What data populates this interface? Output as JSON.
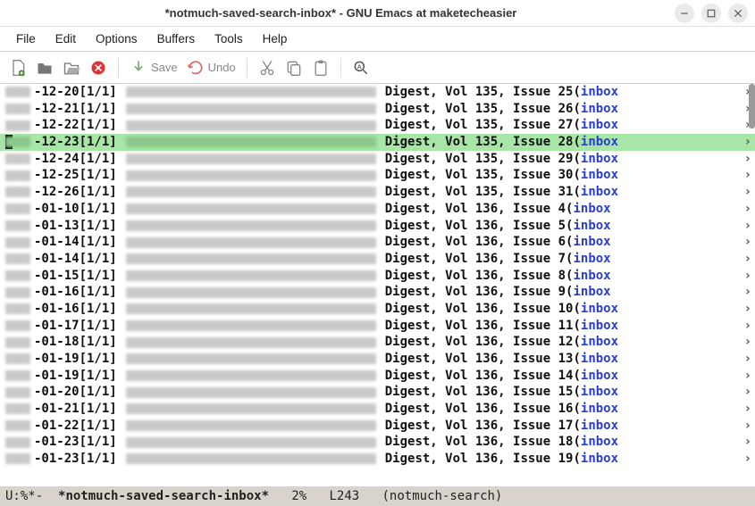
{
  "window": {
    "title": "*notmuch-saved-search-inbox* - GNU Emacs at maketecheasier"
  },
  "menu": {
    "items": [
      "File",
      "Edit",
      "Options",
      "Buffers",
      "Tools",
      "Help"
    ]
  },
  "toolbar": {
    "save_label": "Save",
    "undo_label": "Undo"
  },
  "modeline": {
    "status": "U:%*-",
    "buffer": "*notmuch-saved-search-inbox*",
    "percent": "2%",
    "line": "L243",
    "mode": "(notmuch-search)"
  },
  "selected_index": 3,
  "rows": [
    {
      "date": "-12-20",
      "count": "[1/1]",
      "subject": "Digest, Vol 135, Issue 25",
      "tag": "inbox",
      "arrow": "›"
    },
    {
      "date": "-12-21",
      "count": "[1/1]",
      "subject": "Digest, Vol 135, Issue 26",
      "tag": "inbox",
      "arrow": "›"
    },
    {
      "date": "-12-22",
      "count": "[1/1]",
      "subject": "Digest, Vol 135, Issue 27",
      "tag": "inbox",
      "arrow": "›"
    },
    {
      "date": "-12-23",
      "count": "[1/1]",
      "subject": "Digest, Vol 135, Issue 28",
      "tag": "inbox",
      "arrow": "›"
    },
    {
      "date": "-12-24",
      "count": "[1/1]",
      "subject": "Digest, Vol 135, Issue 29",
      "tag": "inbox",
      "arrow": "›"
    },
    {
      "date": "-12-25",
      "count": "[1/1]",
      "subject": "Digest, Vol 135, Issue 30",
      "tag": "inbox",
      "arrow": "›"
    },
    {
      "date": "-12-26",
      "count": "[1/1]",
      "subject": "Digest, Vol 135, Issue 31",
      "tag": "inbox",
      "arrow": "›"
    },
    {
      "date": "-01-10",
      "count": "[1/1]",
      "subject": "Digest, Vol 136, Issue 4",
      "tag": "inbox",
      "arrow": "›",
      "pad": " "
    },
    {
      "date": "-01-13",
      "count": "[1/1]",
      "subject": "Digest, Vol 136, Issue 5",
      "tag": "inbox",
      "arrow": "›",
      "pad": " "
    },
    {
      "date": "-01-14",
      "count": "[1/1]",
      "subject": "Digest, Vol 136, Issue 6",
      "tag": "inbox",
      "arrow": "›",
      "pad": " "
    },
    {
      "date": "-01-14",
      "count": "[1/1]",
      "subject": "Digest, Vol 136, Issue 7",
      "tag": "inbox",
      "arrow": "›",
      "pad": " "
    },
    {
      "date": "-01-15",
      "count": "[1/1]",
      "subject": "Digest, Vol 136, Issue 8",
      "tag": "inbox",
      "arrow": "›",
      "pad": " "
    },
    {
      "date": "-01-16",
      "count": "[1/1]",
      "subject": "Digest, Vol 136, Issue 9",
      "tag": "inbox",
      "arrow": "›",
      "pad": " "
    },
    {
      "date": "-01-16",
      "count": "[1/1]",
      "subject": "Digest, Vol 136, Issue 10",
      "tag": "inbox",
      "arrow": "›"
    },
    {
      "date": "-01-17",
      "count": "[1/1]",
      "subject": "Digest, Vol 136, Issue 11",
      "tag": "inbox",
      "arrow": "›"
    },
    {
      "date": "-01-18",
      "count": "[1/1]",
      "subject": "Digest, Vol 136, Issue 12",
      "tag": "inbox",
      "arrow": "›"
    },
    {
      "date": "-01-19",
      "count": "[1/1]",
      "subject": "Digest, Vol 136, Issue 13",
      "tag": "inbox",
      "arrow": "›"
    },
    {
      "date": "-01-19",
      "count": "[1/1]",
      "subject": "Digest, Vol 136, Issue 14",
      "tag": "inbox",
      "arrow": "›"
    },
    {
      "date": "-01-20",
      "count": "[1/1]",
      "subject": "Digest, Vol 136, Issue 15",
      "tag": "inbox",
      "arrow": "›"
    },
    {
      "date": "-01-21",
      "count": "[1/1]",
      "subject": "Digest, Vol 136, Issue 16",
      "tag": "inbox",
      "arrow": "›"
    },
    {
      "date": "-01-22",
      "count": "[1/1]",
      "subject": "Digest, Vol 136, Issue 17",
      "tag": "inbox",
      "arrow": "›"
    },
    {
      "date": "-01-23",
      "count": "[1/1]",
      "subject": "Digest, Vol 136, Issue 18",
      "tag": "inbox",
      "arrow": "›"
    },
    {
      "date": "-01-23",
      "count": "[1/1]",
      "subject": "Digest, Vol 136, Issue 19",
      "tag": "inbox",
      "arrow": "›"
    }
  ]
}
